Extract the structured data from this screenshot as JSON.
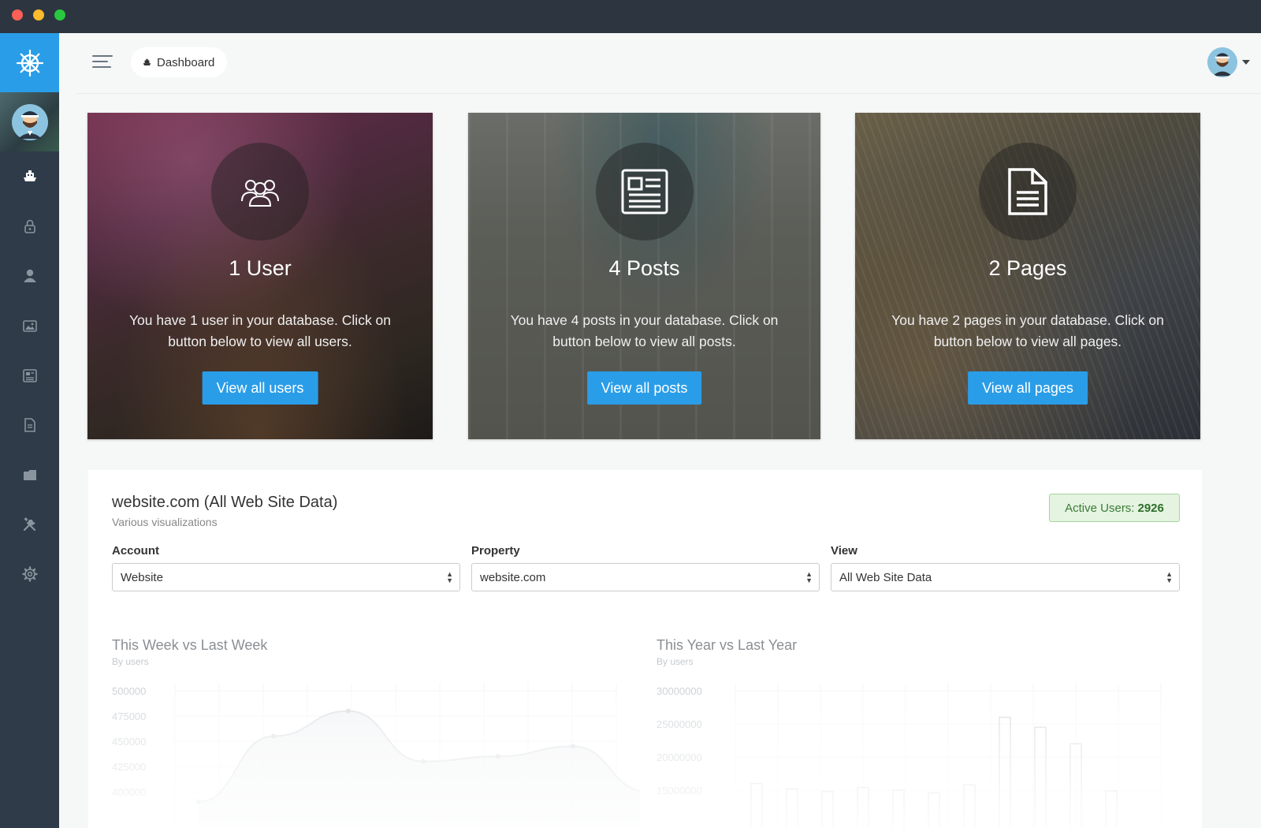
{
  "header": {
    "breadcrumb": "Dashboard"
  },
  "sidebar": {
    "items": [
      {
        "icon": "boat-icon",
        "active": true
      },
      {
        "icon": "lock-icon"
      },
      {
        "icon": "user-icon"
      },
      {
        "icon": "media-icon"
      },
      {
        "icon": "posts-icon"
      },
      {
        "icon": "pages-icon"
      },
      {
        "icon": "folder-icon"
      },
      {
        "icon": "tools-icon"
      },
      {
        "icon": "gear-icon"
      }
    ]
  },
  "cards": [
    {
      "title": "1 User",
      "text": "You have 1 user in your database. Click on button below to view all users.",
      "button": "View all users",
      "icon": "users-icon"
    },
    {
      "title": "4 Posts",
      "text": "You have 4 posts in your database. Click on button below to view all posts.",
      "button": "View all posts",
      "icon": "newspaper-icon"
    },
    {
      "title": "2 Pages",
      "text": "You have 2 pages in your database. Click on button below to view all pages.",
      "button": "View all pages",
      "icon": "document-icon"
    }
  ],
  "analytics": {
    "title": "website.com (All Web Site Data)",
    "subtitle": "Various visualizations",
    "active_label": "Active Users:",
    "active_value": "2926",
    "account_label": "Account",
    "account_value": "Website",
    "property_label": "Property",
    "property_value": "website.com",
    "view_label": "View",
    "view_value": "All Web Site Data"
  },
  "chart_data": [
    {
      "type": "line",
      "title": "This Week vs Last Week",
      "subtitle": "By users",
      "yticks": [
        "500000",
        "475000",
        "450000",
        "425000",
        "400000"
      ],
      "ylim": [
        400000,
        500000
      ],
      "series": [
        {
          "values": [
            390000,
            455000,
            480000,
            430000,
            435000,
            445000,
            400000
          ]
        }
      ]
    },
    {
      "type": "bar",
      "title": "This Year vs Last Year",
      "subtitle": "By users",
      "yticks": [
        "30000000",
        "25000000",
        "20000000",
        "15000000"
      ],
      "ylim": [
        15000000,
        30000000
      ],
      "values": [
        16000000,
        15200000,
        14800000,
        15400000,
        15000000,
        14600000,
        15800000,
        26000000,
        24500000,
        22000000,
        14900000
      ]
    }
  ],
  "colors": {
    "accent": "#2a9de8",
    "sidebar": "#2f3b48",
    "success_bg": "#e4f4e0"
  }
}
